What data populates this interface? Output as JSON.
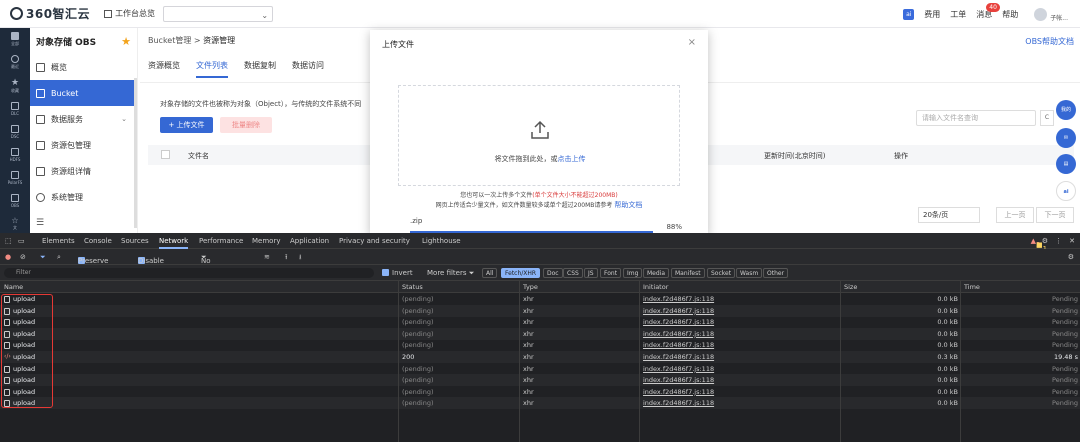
{
  "topbar": {
    "brand": "360智汇云",
    "workspace_label": "工作台总览",
    "workspace_select": "",
    "ai_label": "ai",
    "links": [
      "费用",
      "工单",
      "消息",
      "帮助"
    ],
    "message_badge": "40",
    "user": "子帐..."
  },
  "strip": [
    {
      "label": "全部"
    },
    {
      "label": "最近"
    },
    {
      "label": "收藏"
    },
    {
      "label": "DLC"
    },
    {
      "label": "DSC"
    },
    {
      "label": "HDFS"
    },
    {
      "label": "PolarFS"
    },
    {
      "label": "OBS"
    },
    {
      "label": "文"
    }
  ],
  "sidebar": {
    "title": "对象存储 OBS",
    "items": [
      {
        "label": "概览"
      },
      {
        "label": "Bucket"
      },
      {
        "label": "数据服务"
      },
      {
        "label": "资源包管理"
      },
      {
        "label": "资源组详情"
      },
      {
        "label": "系统管理"
      }
    ]
  },
  "main": {
    "breadcrumb_parent": "Bucket管理",
    "breadcrumb_sep": ">",
    "breadcrumb_current": "资源管理",
    "help_link": "OBS帮助文档",
    "tabs": [
      "资源概览",
      "文件列表",
      "数据复制",
      "数据访问"
    ],
    "description": "对象存储的文件也被称为对象（Object），与传统的文件系统不同",
    "upload_button": "+ 上传文件",
    "delete_button": "批量删除",
    "search_placeholder": "请输入文件名查询",
    "search_btn": "C",
    "columns": [
      "文件名",
      "更新时间(北京时间)",
      "操作"
    ],
    "page_size": "20条/页",
    "prev": "上一页",
    "next": "下一页"
  },
  "floating": [
    "我的",
    "",
    "",
    "ai"
  ],
  "modal": {
    "title": "上传文件",
    "close": "×",
    "drop_text": "将文件拖到此处，或",
    "drop_link": "点击上传",
    "note1_a": "您也可以一次上传多个文件",
    "note1_b": "(单个文件大小不能超过200MB)",
    "note2": "网页上传适合少量文件，如文件数量较多或单个超过200MB请参考",
    "note2_link": "帮助文档",
    "file_name": ".zip",
    "progress": "88%"
  },
  "devtools": {
    "tabs": [
      "Elements",
      "Console",
      "Sources",
      "Network",
      "Performance",
      "Memory",
      "Application",
      "Privacy and security",
      "Lighthouse"
    ],
    "errors": "3",
    "warnings": "1",
    "preserve_log": "Preserve log",
    "disable_cache": "Disable cache",
    "throttling": "No throttling",
    "filter_placeholder": "Filter",
    "invert": "Invert",
    "more_filters": "More filters",
    "filter_pills": [
      "All",
      "Fetch/XHR",
      "Doc",
      "CSS",
      "JS",
      "Font",
      "Img",
      "Media",
      "Manifest",
      "Socket",
      "Wasm",
      "Other"
    ],
    "columns": [
      "Name",
      "Status",
      "Type",
      "Initiator",
      "Size",
      "Time"
    ],
    "rows": [
      {
        "name": "upload",
        "status": "(pending)",
        "type": "xhr",
        "initiator": "index.f2d486f7.js:118",
        "size": "0.0 kB",
        "time": "Pending"
      },
      {
        "name": "upload",
        "status": "(pending)",
        "type": "xhr",
        "initiator": "index.f2d486f7.js:118",
        "size": "0.0 kB",
        "time": "Pending"
      },
      {
        "name": "upload",
        "status": "(pending)",
        "type": "xhr",
        "initiator": "index.f2d486f7.js:118",
        "size": "0.0 kB",
        "time": "Pending"
      },
      {
        "name": "upload",
        "status": "(pending)",
        "type": "xhr",
        "initiator": "index.f2d486f7.js:118",
        "size": "0.0 kB",
        "time": "Pending"
      },
      {
        "name": "upload",
        "status": "(pending)",
        "type": "xhr",
        "initiator": "index.f2d486f7.js:118",
        "size": "0.0 kB",
        "time": "Pending"
      },
      {
        "name": "upload",
        "status": "200",
        "type": "xhr",
        "initiator": "index.f2d486f7.js:118",
        "size": "0.3 kB",
        "time": "19.48 s"
      },
      {
        "name": "upload",
        "status": "(pending)",
        "type": "xhr",
        "initiator": "index.f2d486f7.js:118",
        "size": "0.0 kB",
        "time": "Pending"
      },
      {
        "name": "upload",
        "status": "(pending)",
        "type": "xhr",
        "initiator": "index.f2d486f7.js:118",
        "size": "0.0 kB",
        "time": "Pending"
      },
      {
        "name": "upload",
        "status": "(pending)",
        "type": "xhr",
        "initiator": "index.f2d486f7.js:118",
        "size": "0.0 kB",
        "time": "Pending"
      },
      {
        "name": "upload",
        "status": "(pending)",
        "type": "xhr",
        "initiator": "index.f2d486f7.js:118",
        "size": "0.0 kB",
        "time": "Pending"
      }
    ]
  }
}
